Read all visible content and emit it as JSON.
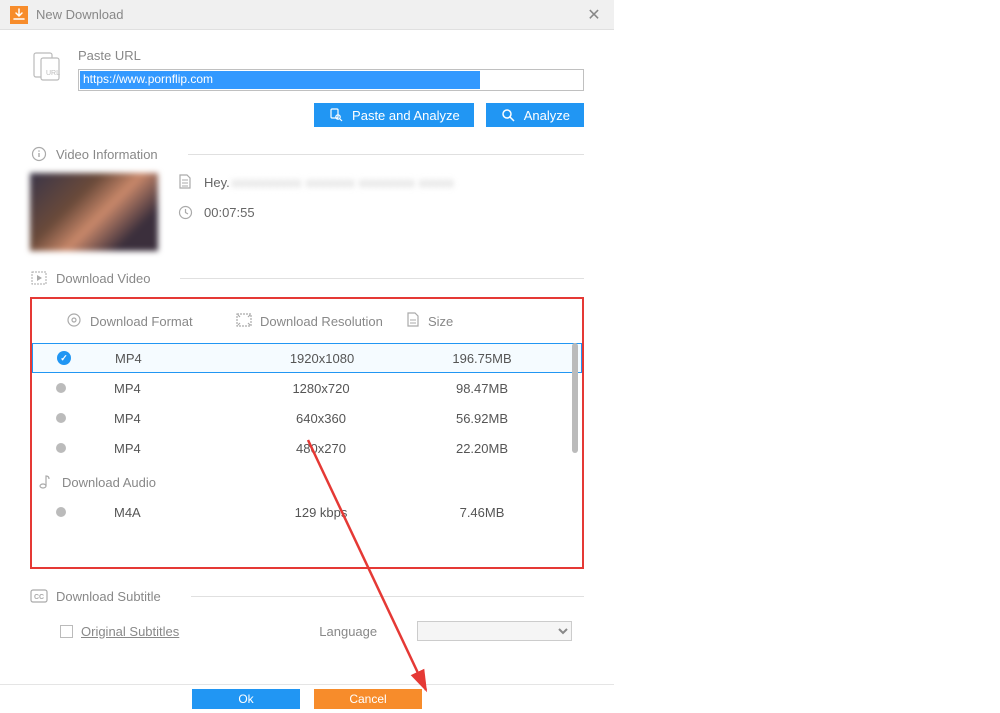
{
  "title": "New Download",
  "paste_url_label": "Paste URL",
  "url_value": "https://www.pornflip.com",
  "btn_paste_analyze": "Paste and Analyze",
  "btn_analyze": "Analyze",
  "section_video_info": "Video Information",
  "video_title_visible": "Hey.",
  "video_duration": "00:07:55",
  "section_download_video": "Download Video",
  "col_format": "Download Format",
  "col_resolution": "Download Resolution",
  "col_size": "Size",
  "video_rows": [
    {
      "format": "MP4",
      "res": "1920x1080",
      "size": "196.75MB",
      "selected": true
    },
    {
      "format": "MP4",
      "res": "1280x720",
      "size": "98.47MB",
      "selected": false
    },
    {
      "format": "MP4",
      "res": "640x360",
      "size": "56.92MB",
      "selected": false
    },
    {
      "format": "MP4",
      "res": "480x270",
      "size": "22.20MB",
      "selected": false
    }
  ],
  "section_download_audio": "Download Audio",
  "audio_rows": [
    {
      "format": "M4A",
      "res": "129 kbps",
      "size": "7.46MB",
      "selected": false
    }
  ],
  "section_download_subtitle": "Download Subtitle",
  "original_subtitles": "Original Subtitles",
  "language_label": "Language",
  "btn_ok": "Ok",
  "btn_cancel": "Cancel"
}
